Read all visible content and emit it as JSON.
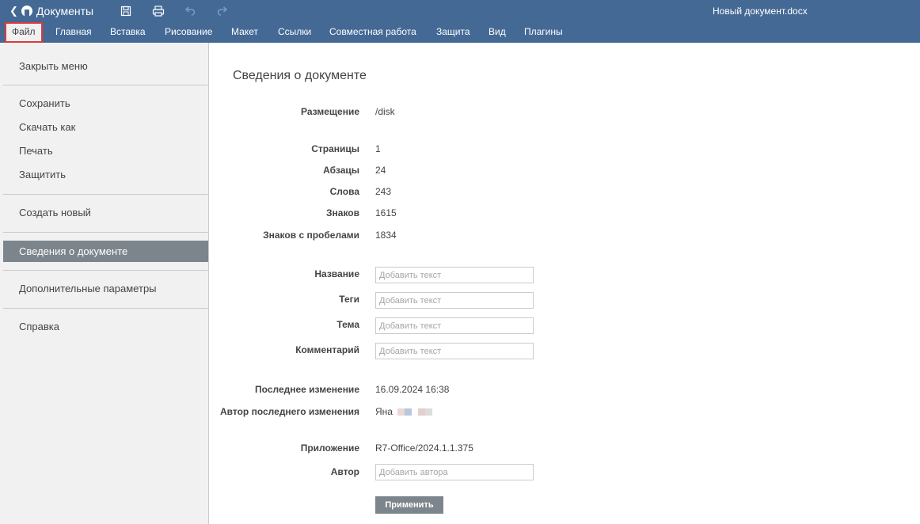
{
  "titlebar": {
    "app_name": "Документы",
    "document_name": "Новый документ.docx"
  },
  "menu": {
    "tabs": [
      {
        "label": "Файл",
        "active": true
      },
      {
        "label": "Главная"
      },
      {
        "label": "Вставка"
      },
      {
        "label": "Рисование"
      },
      {
        "label": "Макет"
      },
      {
        "label": "Ссылки"
      },
      {
        "label": "Совместная работа"
      },
      {
        "label": "Защита"
      },
      {
        "label": "Вид"
      },
      {
        "label": "Плагины"
      }
    ]
  },
  "sidebar": {
    "items": [
      {
        "label": "Закрыть меню"
      },
      {
        "label": "Сохранить"
      },
      {
        "label": "Скачать как"
      },
      {
        "label": "Печать"
      },
      {
        "label": "Защитить"
      },
      {
        "label": "Создать новый"
      },
      {
        "label": "Сведения о документе",
        "selected": true
      },
      {
        "label": "Дополнительные параметры"
      },
      {
        "label": "Справка"
      }
    ]
  },
  "info": {
    "heading": "Сведения о документе",
    "location": {
      "label": "Размещение",
      "value": "/disk"
    },
    "stats": [
      {
        "label": "Страницы",
        "value": "1"
      },
      {
        "label": "Абзацы",
        "value": "24"
      },
      {
        "label": "Слова",
        "value": "243"
      },
      {
        "label": "Знаков",
        "value": "1615"
      },
      {
        "label": "Знаков с пробелами",
        "value": "1834"
      }
    ],
    "fields": [
      {
        "label": "Название",
        "value": "",
        "placeholder": "Добавить текст"
      },
      {
        "label": "Теги",
        "value": "",
        "placeholder": "Добавить текст"
      },
      {
        "label": "Тема",
        "value": "",
        "placeholder": "Добавить текст"
      },
      {
        "label": "Комментарий",
        "value": "",
        "placeholder": "Добавить текст"
      }
    ],
    "last_modified": {
      "label": "Последнее изменение",
      "value": "16.09.2024 16:38"
    },
    "last_modified_by": {
      "label": "Автор последнего изменения",
      "value": "Яна"
    },
    "application": {
      "label": "Приложение",
      "value": "R7-Office/2024.1.1.375"
    },
    "author": {
      "label": "Автор",
      "value": "",
      "placeholder": "Добавить автора"
    },
    "apply_label": "Применить"
  },
  "colors": {
    "header_blue": "#446995",
    "sidebar_bg": "#f1f1f1",
    "selected_bg": "#7d858c",
    "active_tab_outline": "#e03a3a"
  },
  "icons": [
    "back-chevron-icon",
    "app-logo-icon",
    "save-icon",
    "print-icon",
    "undo-icon",
    "redo-icon"
  ]
}
